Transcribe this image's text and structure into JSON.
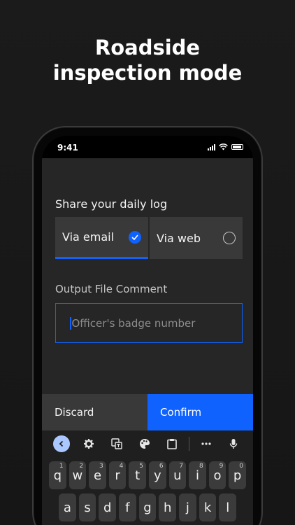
{
  "headline": {
    "line1": "Roadside",
    "line2": "inspection mode"
  },
  "status_bar": {
    "time": "9:41"
  },
  "share": {
    "title": "Share your daily log",
    "options": [
      {
        "label": "Via email",
        "selected": true
      },
      {
        "label": "Via web",
        "selected": false
      }
    ]
  },
  "comment": {
    "label": "Output File Comment",
    "placeholder": "Officer's badge number",
    "value": ""
  },
  "actions": {
    "discard": "Discard",
    "confirm": "Confirm"
  },
  "keyboard": {
    "toolbar_icons": [
      "back-icon",
      "gear-icon",
      "translate-icon",
      "palette-icon",
      "clipboard-icon",
      "more-icon",
      "mic-icon"
    ],
    "row1": [
      {
        "k": "q",
        "n": "1"
      },
      {
        "k": "w",
        "n": "2"
      },
      {
        "k": "e",
        "n": "3"
      },
      {
        "k": "r",
        "n": "4"
      },
      {
        "k": "t",
        "n": "5"
      },
      {
        "k": "y",
        "n": "6"
      },
      {
        "k": "u",
        "n": "7"
      },
      {
        "k": "i",
        "n": "8"
      },
      {
        "k": "o",
        "n": "9"
      },
      {
        "k": "p",
        "n": "0"
      }
    ],
    "row2": [
      "a",
      "s",
      "d",
      "f",
      "g",
      "h",
      "j",
      "k",
      "l"
    ]
  },
  "colors": {
    "accent": "#0f62fe",
    "surface": "#262626",
    "field": "#393939"
  }
}
